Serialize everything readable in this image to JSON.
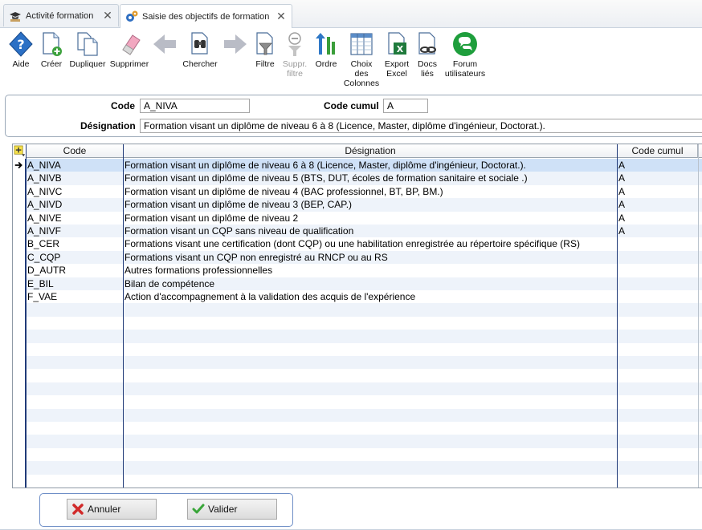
{
  "tabs": [
    {
      "label": "Activité formation"
    },
    {
      "label": "Saisie des objectifs de formation"
    }
  ],
  "toolbar": {
    "aide": "Aide",
    "creer": "Créer",
    "dupliquer": "Dupliquer",
    "supprimer": "Supprimer",
    "chercher": "Chercher",
    "filtre": "Filtre",
    "suppr_filtre_1": "Suppr.",
    "suppr_filtre_2": "filtre",
    "ordre": "Ordre",
    "choix_1": "Choix",
    "choix_2": "des",
    "choix_3": "Colonnes",
    "export_1": "Export",
    "export_2": "Excel",
    "docs_1": "Docs",
    "docs_2": "liés",
    "forum_1": "Forum",
    "forum_2": "utilisateurs"
  },
  "form": {
    "code_label": "Code",
    "code_value": "A_NIVA",
    "code_cumul_label": "Code cumul",
    "code_cumul_value": "A",
    "designation_label": "Désignation",
    "designation_value": "Formation visant un diplôme de niveau 6 à 8 (Licence, Master, diplôme d'ingénieur, Doctorat.)."
  },
  "grid": {
    "columns": {
      "code": "Code",
      "designation": "Désignation",
      "code_cumul": "Code cumul"
    },
    "rows": [
      {
        "code": "A_NIVA",
        "designation": "Formation visant un diplôme de niveau 6 à 8 (Licence, Master, diplôme d'ingénieur, Doctorat.).",
        "cumul": "A"
      },
      {
        "code": "A_NIVB",
        "designation": "Formation visant un diplôme de niveau 5 (BTS, DUT, écoles de formation sanitaire et sociale .)",
        "cumul": "A"
      },
      {
        "code": "A_NIVC",
        "designation": "Formation visant un diplôme de niveau 4 (BAC professionnel, BT, BP, BM.)",
        "cumul": "A"
      },
      {
        "code": "A_NIVD",
        "designation": "Formation visant un diplôme de niveau 3 (BEP, CAP.)",
        "cumul": "A"
      },
      {
        "code": "A_NIVE",
        "designation": "Formation visant un diplôme de niveau 2",
        "cumul": "A"
      },
      {
        "code": "A_NIVF",
        "designation": "Formation visant un CQP sans niveau de qualification",
        "cumul": "A"
      },
      {
        "code": "B_CER",
        "designation": "Formations visant une certification (dont CQP) ou une habilitation enregistrée au répertoire spécifique (RS)",
        "cumul": ""
      },
      {
        "code": "C_CQP",
        "designation": "Formations visant un CQP non enregistré au RNCP ou au RS",
        "cumul": ""
      },
      {
        "code": "D_AUTR",
        "designation": "Autres formations professionnelles",
        "cumul": ""
      },
      {
        "code": "E_BIL",
        "designation": "Bilan de compétence",
        "cumul": ""
      },
      {
        "code": "F_VAE",
        "designation": "Action d'accompagnement à la validation des acquis de l'expérience",
        "cumul": ""
      }
    ]
  },
  "buttons": {
    "annuler": "Annuler",
    "valider": "Valider"
  }
}
